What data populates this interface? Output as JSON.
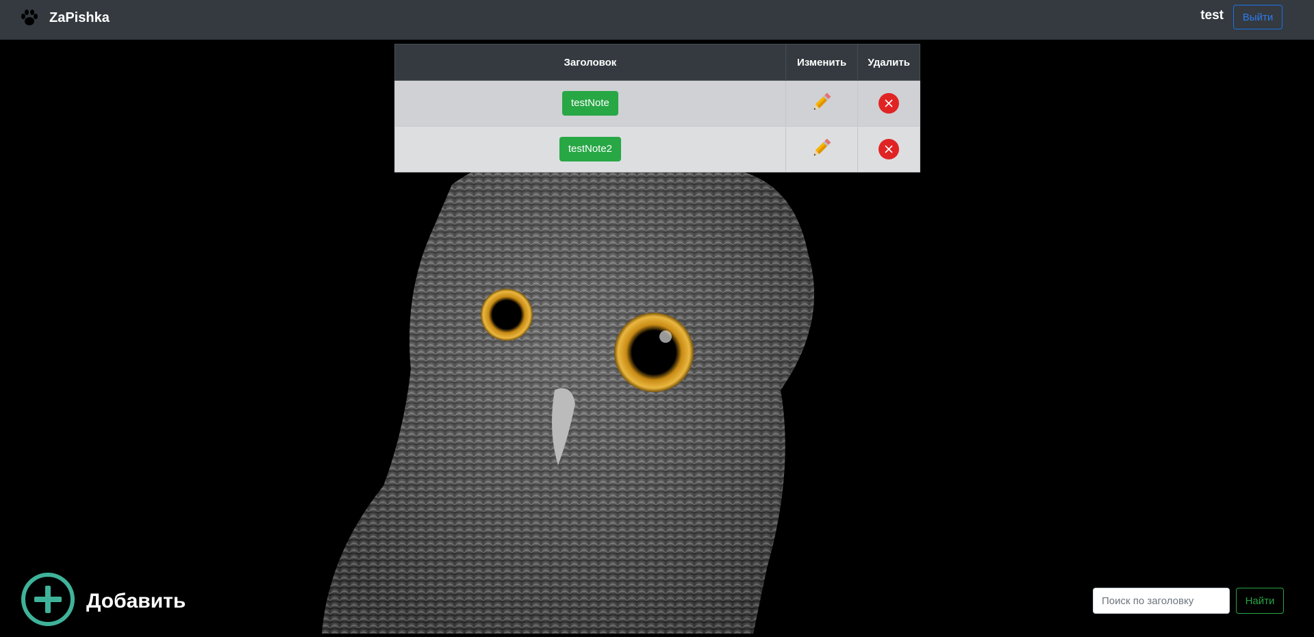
{
  "navbar": {
    "brand_icon": "paw-icon",
    "brand_name": "ZaPishka",
    "user_name": "test",
    "logout_label": "Выйти"
  },
  "background": {
    "image": "owl-photo"
  },
  "table": {
    "headers": {
      "title": "Заголовок",
      "edit": "Изменить",
      "delete": "Удалить"
    },
    "rows": [
      {
        "title": "testNote",
        "edit_icon": "pencil-icon",
        "delete_icon": "close-circle-icon"
      },
      {
        "title": "testNote2",
        "edit_icon": "pencil-icon",
        "delete_icon": "close-circle-icon"
      }
    ]
  },
  "add": {
    "icon": "plus-circle-icon",
    "label": "Добавить"
  },
  "search": {
    "placeholder": "Поиск по заголовку",
    "value": "",
    "button_label": "Найти"
  },
  "colors": {
    "navbar_bg": "#343a40",
    "success": "#28a745",
    "danger": "#e02424",
    "primary": "#1a73e8",
    "add_accent": "#3fb39a"
  }
}
